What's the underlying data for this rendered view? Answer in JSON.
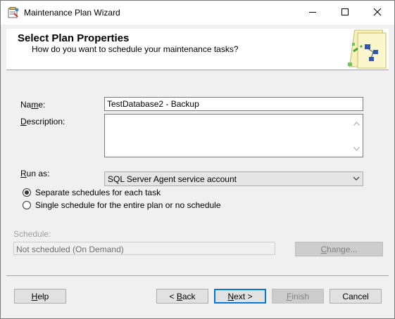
{
  "window": {
    "title": "Maintenance Plan Wizard",
    "app_icon": "wizard-app-icon",
    "controls": [
      "minimize-icon",
      "maximize-icon",
      "close-icon"
    ]
  },
  "header": {
    "title": "Select Plan Properties",
    "subtitle": "How do you want to schedule your maintenance tasks?",
    "art_icon": "wizard-header-graphic"
  },
  "form": {
    "name_label_pre": "Na",
    "name_label_ul": "m",
    "name_label_post": "e:",
    "name_value": "TestDatabase2 - Backup",
    "description_label_ul": "D",
    "description_label_post": "escription:",
    "description_value": "",
    "run_as_label_ul": "R",
    "run_as_label_post": "un as:",
    "run_as_value": "SQL Server Agent service account",
    "schedule_options": [
      {
        "label": "Separate schedules for each task",
        "selected": true
      },
      {
        "label": "Single schedule for the entire plan or no schedule",
        "selected": false
      }
    ],
    "schedule_label": "Schedule:",
    "schedule_value": "Not scheduled (On Demand)",
    "change_pre": "",
    "change_ul": "C",
    "change_post": "hange..."
  },
  "buttons": {
    "help_ul": "H",
    "help_post": "elp",
    "back_pre": "< ",
    "back_ul": "B",
    "back_post": "ack",
    "next_ul": "N",
    "next_post": "ext >",
    "finish_ul": "F",
    "finish_post": "inish",
    "cancel": "Cancel"
  }
}
